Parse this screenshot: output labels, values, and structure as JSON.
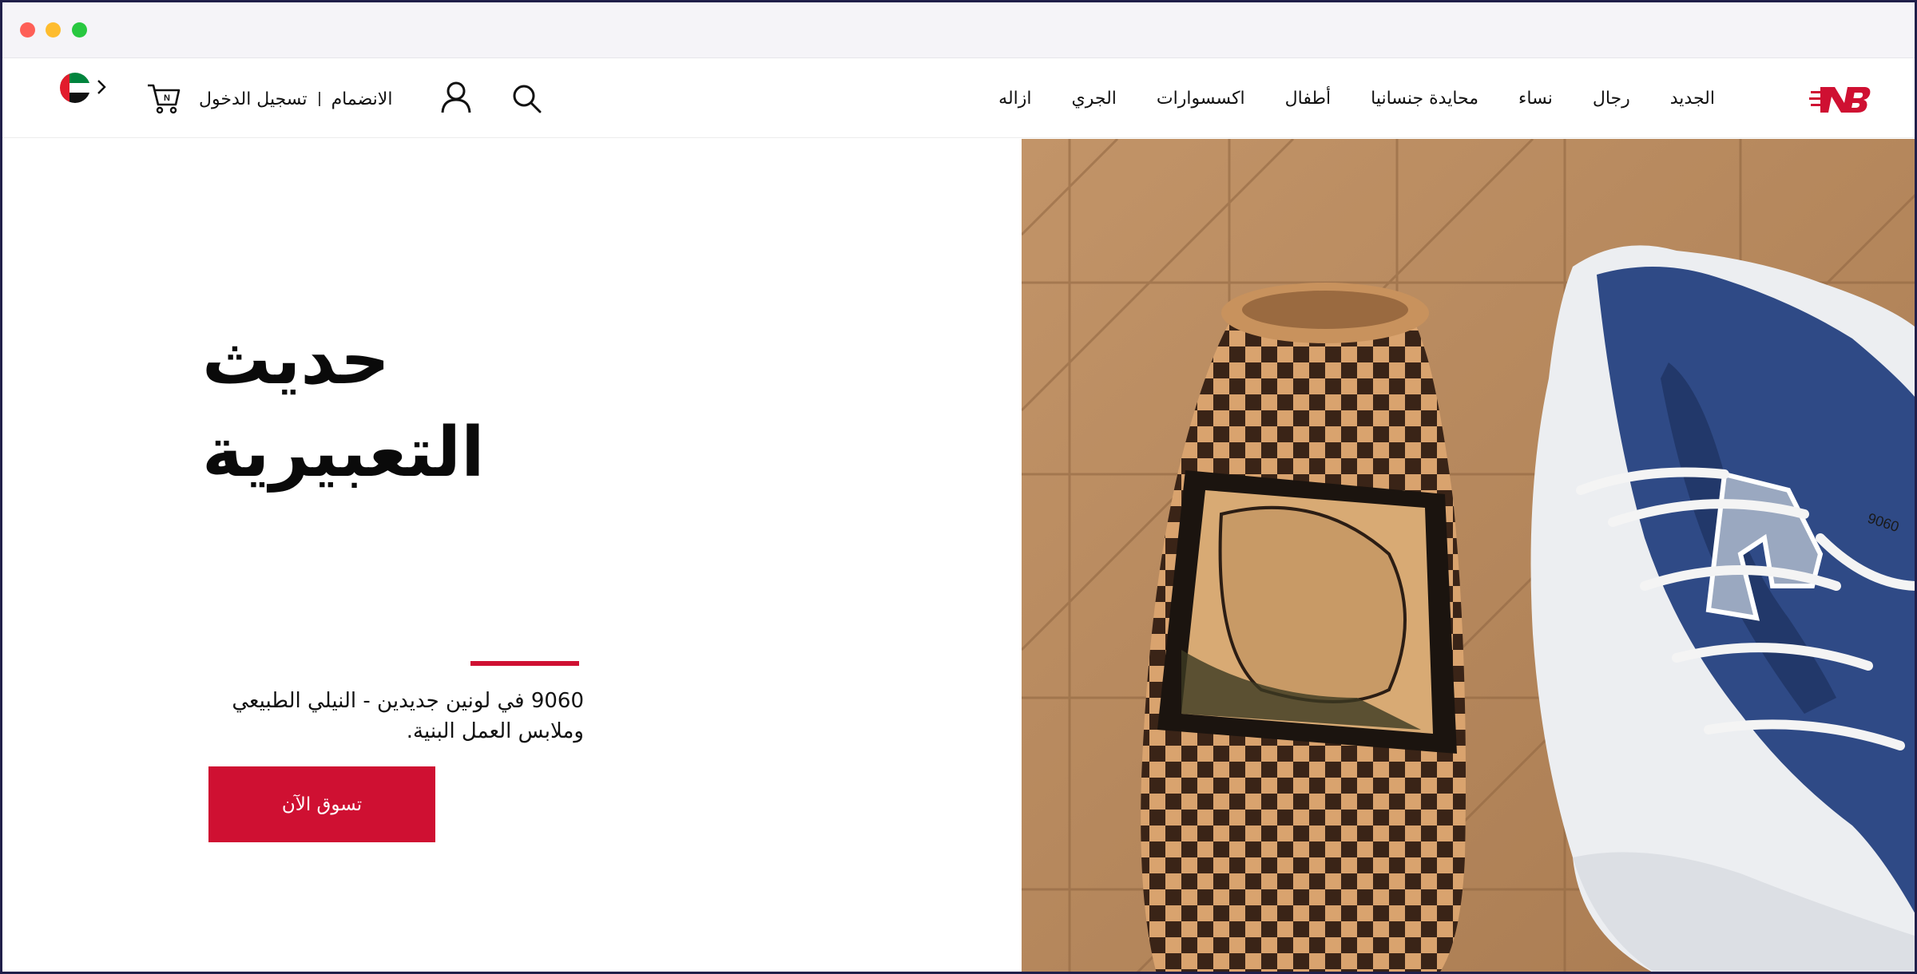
{
  "nav": {
    "items": [
      {
        "label": "الجديد"
      },
      {
        "label": "رجال"
      },
      {
        "label": "نساء"
      },
      {
        "label": "محايدة جنسانيا"
      },
      {
        "label": "أطفال"
      },
      {
        "label": "اكسسوارات"
      },
      {
        "label": "الجري"
      },
      {
        "label": "ازاله"
      }
    ]
  },
  "header": {
    "login_label": "تسجيل الدخول",
    "join_label": "الانضمام",
    "logo_icon": "new-balance-logo",
    "search_icon": "search-icon",
    "user_icon": "user-icon",
    "cart_icon": "cart-icon",
    "flag_icon": "uae-flag-icon"
  },
  "hero": {
    "title_line1": "حديث",
    "title_line2": "التعبيرية",
    "subtitle": "9060 في لونين جديدين - النيلي الطبيعي وملابس العمل البنية.",
    "cta_label": "تسوق الآن",
    "shoe_model": "9060",
    "accent_color": "#cf1032"
  }
}
